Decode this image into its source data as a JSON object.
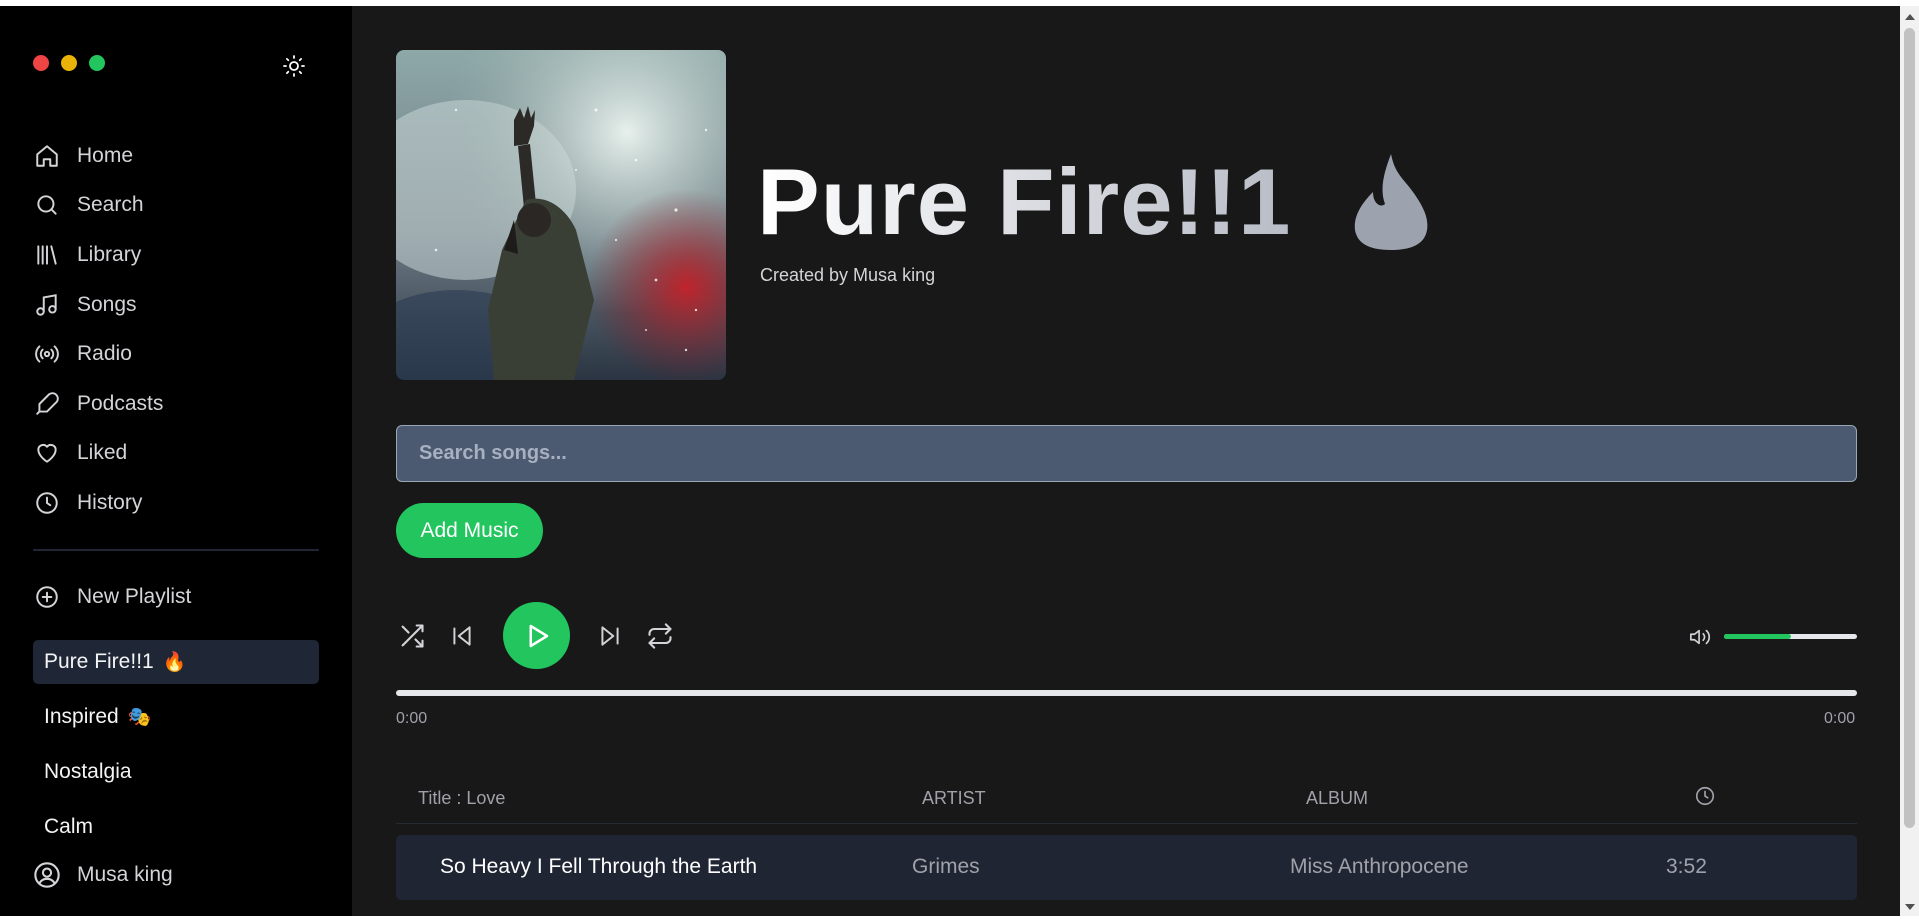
{
  "sidebar": {
    "traffic_lights": [
      "#ef4444",
      "#eab308",
      "#22c55e"
    ],
    "theme_toggle_icon": "sun-icon",
    "nav": [
      {
        "label": "Home",
        "icon": "home-icon"
      },
      {
        "label": "Search",
        "icon": "search-icon"
      },
      {
        "label": "Library",
        "icon": "library-icon"
      },
      {
        "label": "Songs",
        "icon": "music-note-icon"
      },
      {
        "label": "Radio",
        "icon": "radio-icon"
      },
      {
        "label": "Podcasts",
        "icon": "microphone-icon"
      },
      {
        "label": "Liked",
        "icon": "heart-icon"
      },
      {
        "label": "History",
        "icon": "clock-icon"
      }
    ],
    "new_playlist_label": "New Playlist",
    "playlists": [
      {
        "label": "Pure Fire!!1",
        "emoji": "🔥"
      },
      {
        "label": "Inspired",
        "emoji": "🎭"
      },
      {
        "label": "Nostalgia",
        "emoji": ""
      },
      {
        "label": "Calm",
        "emoji": ""
      }
    ],
    "user_name": "Musa king"
  },
  "playlist": {
    "title": "Pure Fire!!1",
    "created_by": "Created by Musa king"
  },
  "search": {
    "placeholder": "Search songs..."
  },
  "add_music_label": "Add Music",
  "player": {
    "current_time": "0:00",
    "total_time": "0:00",
    "progress": 0,
    "volume": 0.5
  },
  "table": {
    "headers": {
      "title": "Title : Love",
      "artist": "ARTIST",
      "album": "ALBUM",
      "duration_icon": "clock-icon"
    },
    "rows": [
      {
        "title": "So Heavy I Fell Through the Earth",
        "artist": "Grimes",
        "album": "Miss Anthropocene",
        "duration": "3:52"
      }
    ]
  },
  "colors": {
    "accent": "#22c55e",
    "sidebar_bg": "#000000",
    "main_bg": "#181818",
    "active_playlist_bg": "#1f2737"
  }
}
